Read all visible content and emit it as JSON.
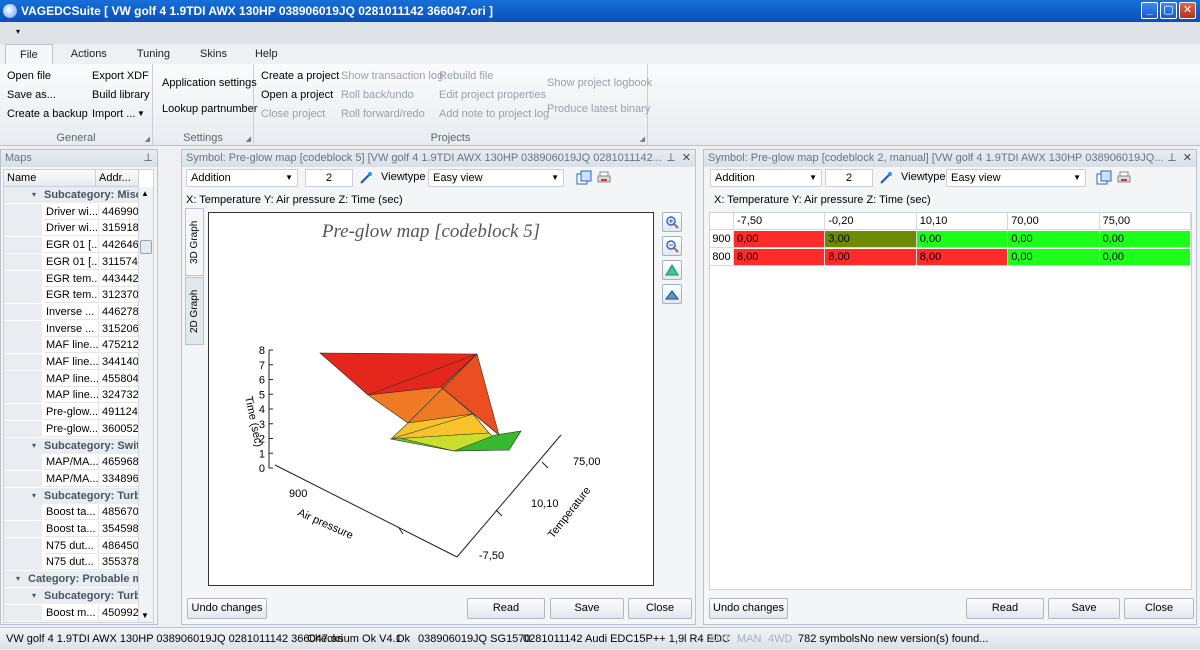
{
  "window": {
    "title": "VAGEDCSuite [ VW golf 4 1.9TDI AWX 130HP 038906019JQ 0281011142 366047.ori ]",
    "buttons": [
      "_",
      "▢",
      "✕"
    ]
  },
  "qat_arrow": "▾",
  "tabs": [
    "File",
    "Actions",
    "Tuning",
    "Skins",
    "Help"
  ],
  "ribbon": {
    "general": {
      "title": "General",
      "items": [
        "Open file",
        "Save as...",
        "Create a backup",
        "Export XDF",
        "Build library",
        "Import ..."
      ]
    },
    "settings": {
      "title": "Settings",
      "items": [
        "Application settings",
        "Lookup partnumber"
      ]
    },
    "projects": {
      "title": "Projects",
      "items": [
        "Create a project",
        "Open a project",
        "Close project",
        "Show transaction log",
        "Roll back/undo",
        "Roll forward/redo",
        "Rebuild file",
        "Edit project properties",
        "Add note to project log",
        "Show project logbook",
        "Produce latest binary"
      ]
    }
  },
  "maps_panel": {
    "title": "Maps",
    "columns": [
      "Name",
      "Addr..."
    ],
    "rows": [
      {
        "type": "sub",
        "label": "Subcategory: Misc"
      },
      {
        "type": "item",
        "name": "Driver wi...",
        "addr": "446990"
      },
      {
        "type": "item",
        "name": "Driver wi...",
        "addr": "315918"
      },
      {
        "type": "item",
        "name": "EGR 01 [...",
        "addr": "442646"
      },
      {
        "type": "item",
        "name": "EGR 01 [...",
        "addr": "311574"
      },
      {
        "type": "item",
        "name": "EGR tem...",
        "addr": "443442"
      },
      {
        "type": "item",
        "name": "EGR tem...",
        "addr": "312370"
      },
      {
        "type": "item",
        "name": "Inverse ...",
        "addr": "446278"
      },
      {
        "type": "item",
        "name": "Inverse ...",
        "addr": "315206"
      },
      {
        "type": "item",
        "name": "MAF line...",
        "addr": "475212"
      },
      {
        "type": "item",
        "name": "MAF line...",
        "addr": "344140"
      },
      {
        "type": "item",
        "name": "MAP line...",
        "addr": "455804"
      },
      {
        "type": "item",
        "name": "MAP line...",
        "addr": "324732"
      },
      {
        "type": "item",
        "name": "Pre-glow...",
        "addr": "491124"
      },
      {
        "type": "item",
        "name": "Pre-glow...",
        "addr": "360052"
      },
      {
        "type": "sub",
        "label": "Subcategory: Swit"
      },
      {
        "type": "item",
        "name": "MAP/MA...",
        "addr": "465968"
      },
      {
        "type": "item",
        "name": "MAP/MA...",
        "addr": "334896"
      },
      {
        "type": "sub",
        "label": "Subcategory: Turb"
      },
      {
        "type": "item",
        "name": "Boost ta...",
        "addr": "485670"
      },
      {
        "type": "item",
        "name": "Boost ta...",
        "addr": "354598"
      },
      {
        "type": "item",
        "name": "N75 dut...",
        "addr": "486450"
      },
      {
        "type": "item",
        "name": "N75 dut...",
        "addr": "355378"
      },
      {
        "type": "cat",
        "label": "Category: Probable ma"
      },
      {
        "type": "sub",
        "label": "Subcategory: Turb"
      },
      {
        "type": "item",
        "name": "Boost m...",
        "addr": "450992"
      }
    ]
  },
  "symbol_left": {
    "title": "Symbol: Pre-glow map [codeblock 5] [VW golf 4 1.9TDI AWX 130HP 038906019JQ 0281011142...",
    "mode": "Addition",
    "value": "2",
    "viewtype_label": "Viewtype",
    "viewtype": "Easy view",
    "axis_info": "X: Temperature Y: Air pressure Z: Time (sec)",
    "vtabs": [
      "3D Graph",
      "2D Graph"
    ],
    "buttons": [
      "Undo changes",
      "Read",
      "Save",
      "Close"
    ]
  },
  "symbol_right": {
    "title": "Symbol: Pre-glow map [codeblock 2, manual] [VW golf 4 1.9TDI AWX 130HP 038906019JQ...",
    "mode": "Addition",
    "value": "2",
    "viewtype_label": "Viewtype",
    "viewtype": "Easy view",
    "axis_info": "X: Temperature Y: Air pressure Z: Time (sec)",
    "buttons": [
      "Undo changes",
      "Read",
      "Save",
      "Close"
    ]
  },
  "grid": {
    "columns": [
      "-7,50",
      "-0,20",
      "10,10",
      "70,00",
      "75,00"
    ],
    "rows": [
      {
        "label": "900",
        "cells": [
          "0,00",
          "3,00",
          "0,00",
          "0,00",
          "0,00"
        ],
        "colors": [
          "#ff2a2a",
          "#708a00",
          "#1bff1b",
          "#1bff1b",
          "#1bff1b"
        ]
      },
      {
        "label": "800",
        "cells": [
          "8,00",
          "8,00",
          "8,00",
          "0,00",
          "0,00"
        ],
        "colors": [
          "#ff2a2a",
          "#ff2a2a",
          "#ff2a2a",
          "#1bff1b",
          "#1bff1b"
        ]
      }
    ]
  },
  "chart_data": {
    "type": "surface",
    "title": "Pre-glow map [codeblock 5]",
    "zlabel": "Time (sec)",
    "ylabel": "Air pressure",
    "xlabel": "Temperature",
    "z_ticks": [
      "0",
      "1",
      "2",
      "3",
      "4",
      "5",
      "6",
      "7",
      "8"
    ],
    "y_ticks": [
      "900"
    ],
    "x_ticks": [
      "-7,50",
      "10,10",
      "75,00"
    ],
    "zlim": [
      0,
      8
    ]
  },
  "status": {
    "file": "VW golf 4 1.9TDI AWX 130HP 038906019JQ 0281011142 366047.ori",
    "checksum": "Checksum Ok V4.1",
    "ok": "Ok",
    "part": "038906019JQ SG1570",
    "ecu": "0281011142 Audi EDC15P++ 1,9l R4 EDC",
    "aut": "AUT",
    "man": "MAN",
    "awd": "4WD",
    "symbols": "782 symbols",
    "version": "No new version(s) found..."
  }
}
